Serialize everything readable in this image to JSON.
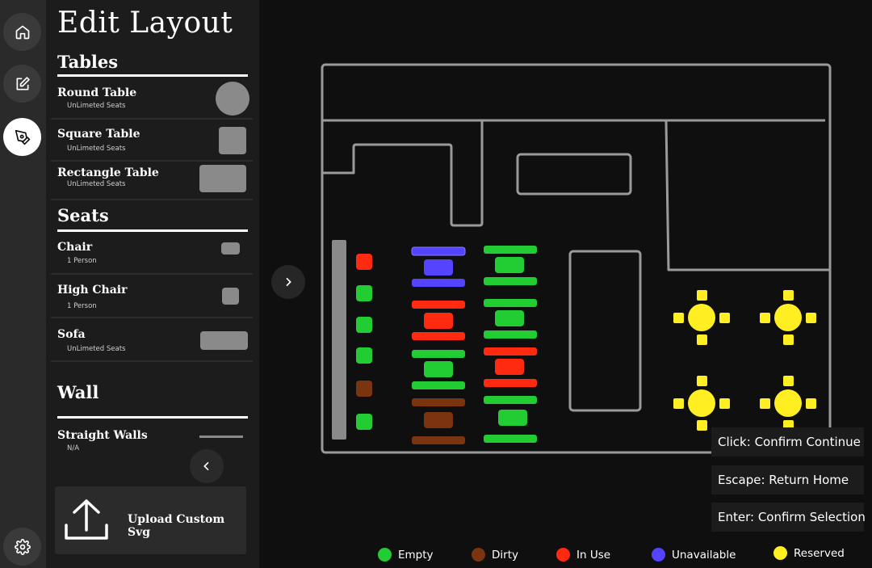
{
  "panel": {
    "title": "Edit Layout",
    "tables": {
      "heading": "Tables",
      "items": [
        {
          "name": "Round Table",
          "sub": "UnLimeted Seats"
        },
        {
          "name": "Square Table",
          "sub": "UnLimeted Seats"
        },
        {
          "name": "Rectangle Table",
          "sub": "UnLimeted Seats"
        }
      ]
    },
    "seats": {
      "heading": "Seats",
      "items": [
        {
          "name": "Chair",
          "sub": "1 Person"
        },
        {
          "name": "High Chair",
          "sub": "1 Person"
        },
        {
          "name": "Sofa",
          "sub": "UnLimeted Seats"
        }
      ]
    },
    "wall": {
      "heading": "Wall",
      "items": [
        {
          "name": "Straight Walls",
          "sub": "N/A"
        }
      ]
    },
    "upload_label": "Upload Custom Svg"
  },
  "rail": {
    "icons": [
      "home-icon",
      "edit-icon",
      "pen-tool-icon",
      "settings-icon"
    ],
    "active": "pen-tool-icon"
  },
  "hints": {
    "click": "Click: Confirm Continue",
    "escape": "Escape: Return Home",
    "enter": "Enter: Confirm Selection"
  },
  "legend": [
    {
      "label": "Empty",
      "color": "#22cc33"
    },
    {
      "label": "Dirty",
      "color": "#7a3410"
    },
    {
      "label": "In Use",
      "color": "#ff2a10"
    },
    {
      "label": "Unavailable",
      "color": "#5544ff"
    },
    {
      "label": "Reserved",
      "color": "#ffee22"
    }
  ],
  "colors": {
    "empty": "#22cc33",
    "dirty": "#7a3410",
    "in_use": "#ff2a10",
    "unavailable": "#5544ff",
    "reserved": "#ffee22",
    "wall": "#9a9a9a"
  }
}
